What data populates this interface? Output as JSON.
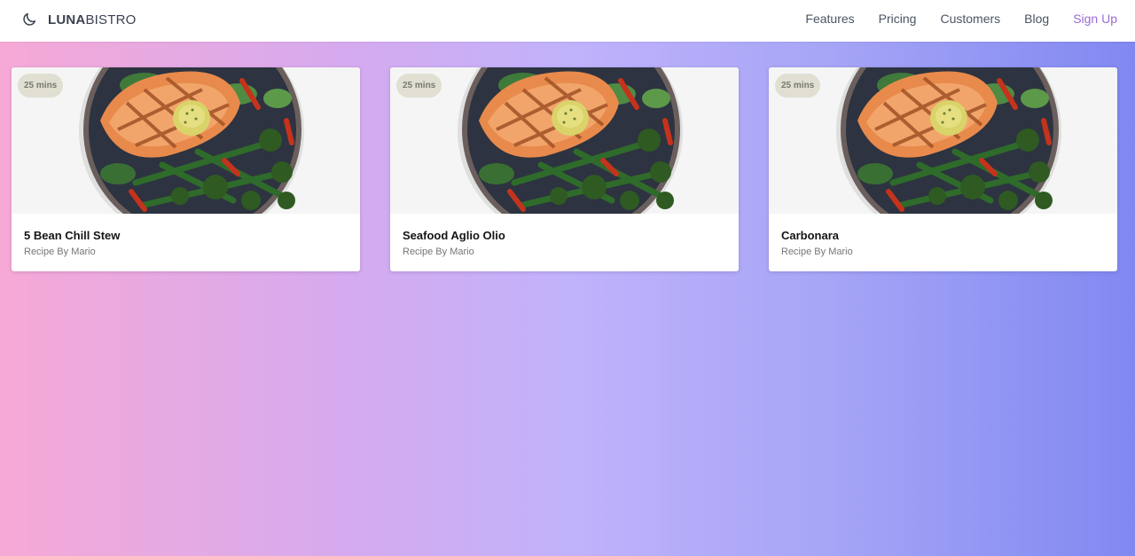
{
  "brand": {
    "bold": "LUNA",
    "light": "BISTRO",
    "icon": "moon-icon"
  },
  "nav": {
    "links": [
      "Features",
      "Pricing",
      "Customers",
      "Blog"
    ],
    "signup": "Sign Up"
  },
  "colors": {
    "accent": "#9a6ad6",
    "gradient_start": "#f6a9d6",
    "gradient_end": "#8188f1"
  },
  "recipes": [
    {
      "time": "25 mins",
      "title": "5 Bean Chill Stew",
      "author": "Recipe By Mario",
      "image_icon": "salmon-plate-image"
    },
    {
      "time": "25 mins",
      "title": "Seafood Aglio Olio",
      "author": "Recipe By Mario",
      "image_icon": "salmon-plate-image"
    },
    {
      "time": "25 mins",
      "title": "Carbonara",
      "author": "Recipe By Mario",
      "image_icon": "salmon-plate-image"
    }
  ]
}
